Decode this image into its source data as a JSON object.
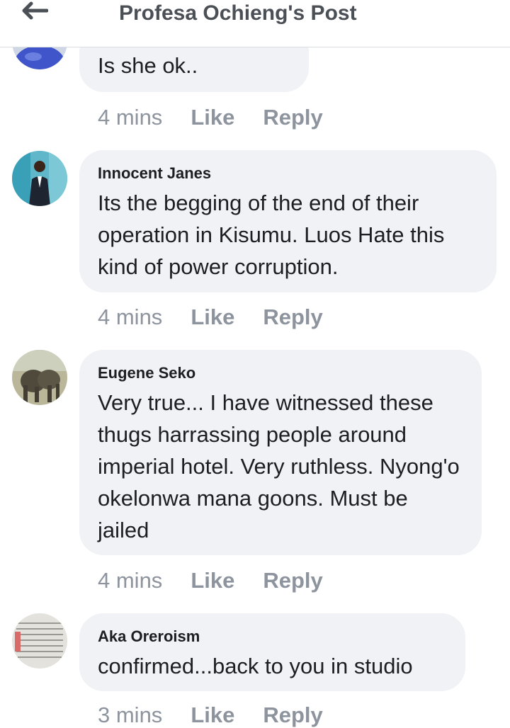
{
  "header": {
    "title": "Profesa Ochieng's Post"
  },
  "comments": [
    {
      "author": "",
      "text": "Is she ok..",
      "time": "4 mins",
      "like": "Like",
      "reply": "Reply"
    },
    {
      "author": "Innocent Janes",
      "text": "Its the begging of the end of their operation in Kisumu. Luos Hate this kind of power corruption.",
      "time": "4 mins",
      "like": "Like",
      "reply": "Reply"
    },
    {
      "author": "Eugene Seko",
      "text": "Very true... I have witnessed these thugs harrassing people around imperial hotel. Very ruthless. Nyong'o okelonwa mana goons. Must be jailed",
      "time": "4 mins",
      "like": "Like",
      "reply": "Reply"
    },
    {
      "author": "Aka Oreroism",
      "text": "confirmed...back to you in studio",
      "time": "3 mins",
      "like": "Like",
      "reply": "Reply"
    }
  ],
  "colors": {
    "bubble": "#f0f2f5",
    "meta": "#8d949e",
    "title": "#4b4f56"
  }
}
